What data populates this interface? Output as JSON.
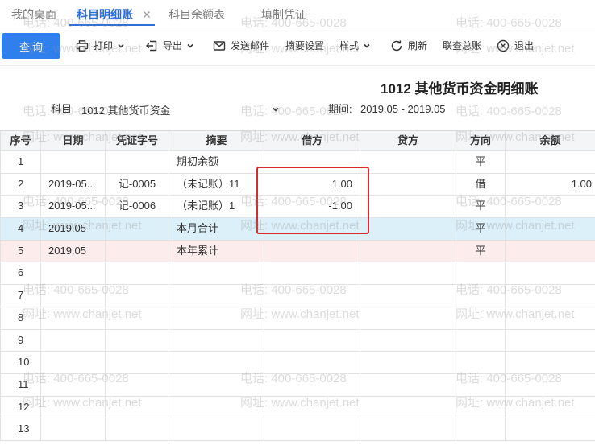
{
  "tabs": [
    {
      "label": "我的桌面",
      "active": false
    },
    {
      "label": "科目明细账",
      "active": true
    },
    {
      "label": "科目余额表",
      "active": false
    },
    {
      "label": "填制凭证",
      "active": false
    }
  ],
  "toolbar": {
    "query": "查询",
    "print": "打印",
    "export": "导出",
    "email": "发送邮件",
    "summary_settings": "摘要设置",
    "style": "样式",
    "refresh": "刷新",
    "linked_ledger": "联查总账",
    "exit": "退出"
  },
  "report": {
    "title": "1012 其他货币资金明细账",
    "subject_label": "科目",
    "subject_value": "1012 其他货币资金",
    "period_label": "期间:",
    "period_value": "2019.05 - 2019.05"
  },
  "table": {
    "columns": [
      "序号",
      "日期",
      "凭证字号",
      "摘要",
      "借方",
      "贷方",
      "方向",
      "余额"
    ],
    "rows": [
      {
        "seq": "1",
        "date": "",
        "voucher": "",
        "summary": "期初余额",
        "debit": "",
        "credit": "",
        "direction": "平",
        "balance": ""
      },
      {
        "seq": "2",
        "date": "2019-05...",
        "voucher": "记-0005",
        "summary": "（未记账）11",
        "debit": "1.00",
        "credit": "",
        "direction": "借",
        "balance": "1.00"
      },
      {
        "seq": "3",
        "date": "2019-05...",
        "voucher": "记-0006",
        "summary": "（未记账）1",
        "debit": "-1.00",
        "credit": "",
        "direction": "平",
        "balance": ""
      },
      {
        "seq": "4",
        "date": "2019.05",
        "voucher": "",
        "summary": "本月合计",
        "debit": "",
        "credit": "",
        "direction": "平",
        "balance": "",
        "bg": "#dcf0fa"
      },
      {
        "seq": "5",
        "date": "2019.05",
        "voucher": "",
        "summary": "本年累计",
        "debit": "",
        "credit": "",
        "direction": "平",
        "balance": "",
        "bg": "#fcecec"
      },
      {
        "seq": "6",
        "date": "",
        "voucher": "",
        "summary": "",
        "debit": "",
        "credit": "",
        "direction": "",
        "balance": ""
      },
      {
        "seq": "7",
        "date": "",
        "voucher": "",
        "summary": "",
        "debit": "",
        "credit": "",
        "direction": "",
        "balance": ""
      },
      {
        "seq": "8",
        "date": "",
        "voucher": "",
        "summary": "",
        "debit": "",
        "credit": "",
        "direction": "",
        "balance": ""
      },
      {
        "seq": "9",
        "date": "",
        "voucher": "",
        "summary": "",
        "debit": "",
        "credit": "",
        "direction": "",
        "balance": ""
      },
      {
        "seq": "10",
        "date": "",
        "voucher": "",
        "summary": "",
        "debit": "",
        "credit": "",
        "direction": "",
        "balance": ""
      },
      {
        "seq": "11",
        "date": "",
        "voucher": "",
        "summary": "",
        "debit": "",
        "credit": "",
        "direction": "",
        "balance": ""
      },
      {
        "seq": "12",
        "date": "",
        "voucher": "",
        "summary": "",
        "debit": "",
        "credit": "",
        "direction": "",
        "balance": ""
      },
      {
        "seq": "13",
        "date": "",
        "voucher": "",
        "summary": "",
        "debit": "",
        "credit": "",
        "direction": "",
        "balance": ""
      }
    ]
  },
  "watermark": {
    "phone": "电话: 400-665-0028",
    "site": "网址: www.chanjet.net"
  },
  "colors": {
    "accent": "#2f80ed",
    "active_tab": "#2b6fd8",
    "link": "#2f6fcf",
    "negative": "#e23b3b",
    "annotation": "#d92a2a"
  },
  "icons": {
    "tab_close": "close-icon",
    "print": "printer-icon",
    "export": "export-icon",
    "email": "envelope-icon",
    "refresh": "refresh-icon",
    "exit": "close-circle-icon",
    "dropdown": "chevron-down-icon"
  }
}
